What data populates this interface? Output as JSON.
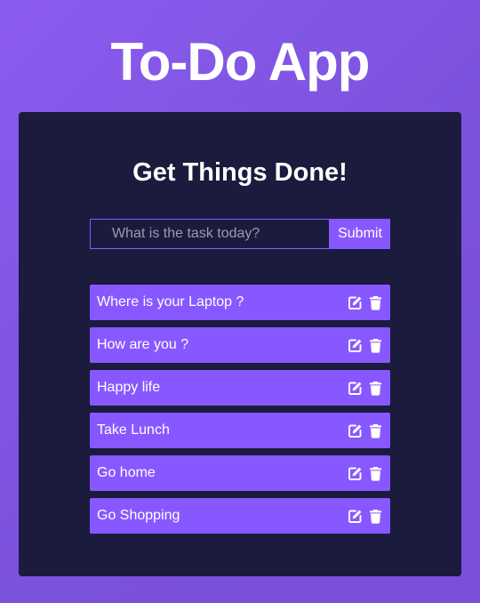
{
  "app": {
    "title": "To-Do App"
  },
  "card": {
    "heading": "Get Things Done!"
  },
  "form": {
    "input_value": "",
    "placeholder": "What is the task today?",
    "submit_label": "Submit"
  },
  "tasks": [
    {
      "text": "Where is your Laptop ?"
    },
    {
      "text": "How are you ?"
    },
    {
      "text": "Happy life"
    },
    {
      "text": "Take Lunch"
    },
    {
      "text": "Go home"
    },
    {
      "text": "Go Shopping"
    }
  ],
  "icons": {
    "edit": "edit-icon",
    "delete": "trash-icon"
  },
  "colors": {
    "background": "#8b5cf0",
    "card": "#1b1b3d",
    "accent": "#8758ff",
    "text": "#ffffff"
  }
}
